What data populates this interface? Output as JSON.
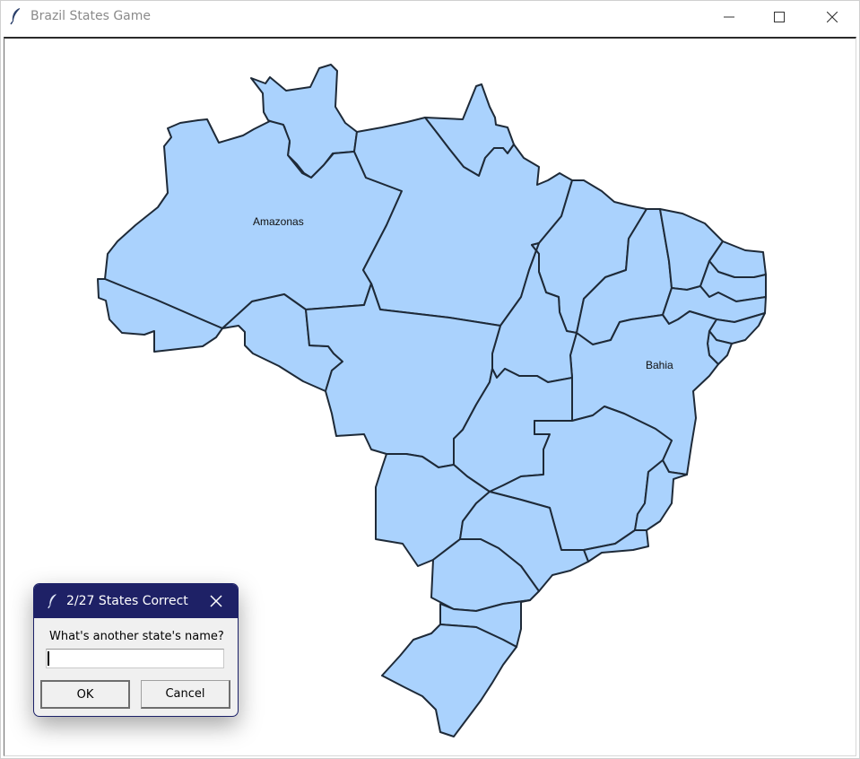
{
  "window": {
    "title": "Brazil States Game",
    "icon": "feather-icon"
  },
  "map": {
    "fill_color": "#aad2fd",
    "stroke_color": "#1e2a38",
    "guessed_labels": [
      {
        "name": "Amazonas"
      },
      {
        "name": "Bahia"
      }
    ]
  },
  "dialog": {
    "title": "2/27 States Correct",
    "prompt": "What's another state's name?",
    "input_value": "",
    "ok_label": "OK",
    "cancel_label": "Cancel",
    "title_bar_color": "#1e2166"
  }
}
